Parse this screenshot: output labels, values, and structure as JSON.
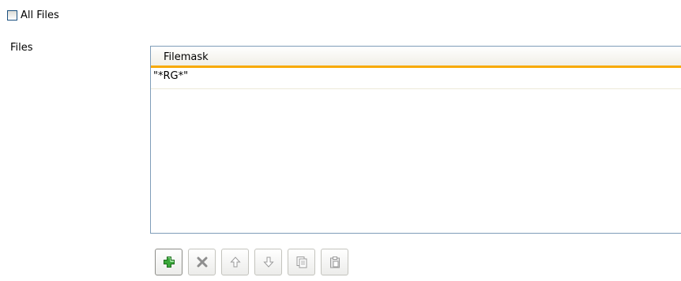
{
  "options": {
    "all_files_label": "All Files",
    "all_files_checked": false
  },
  "files": {
    "label": "Files",
    "table": {
      "columns": [
        "Filemask"
      ],
      "rows": [
        [
          "\"*RG*\""
        ]
      ]
    }
  },
  "toolbar": {
    "buttons": [
      {
        "icon": "plus-icon",
        "enabled": true
      },
      {
        "icon": "delete-icon",
        "enabled": false
      },
      {
        "icon": "arrow-up-icon",
        "enabled": false
      },
      {
        "icon": "arrow-down-icon",
        "enabled": false
      },
      {
        "icon": "copy-icon",
        "enabled": false
      },
      {
        "icon": "paste-icon",
        "enabled": false
      }
    ]
  },
  "colors": {
    "header_underline": "#f8a900",
    "add_green": "#3aa83a"
  }
}
